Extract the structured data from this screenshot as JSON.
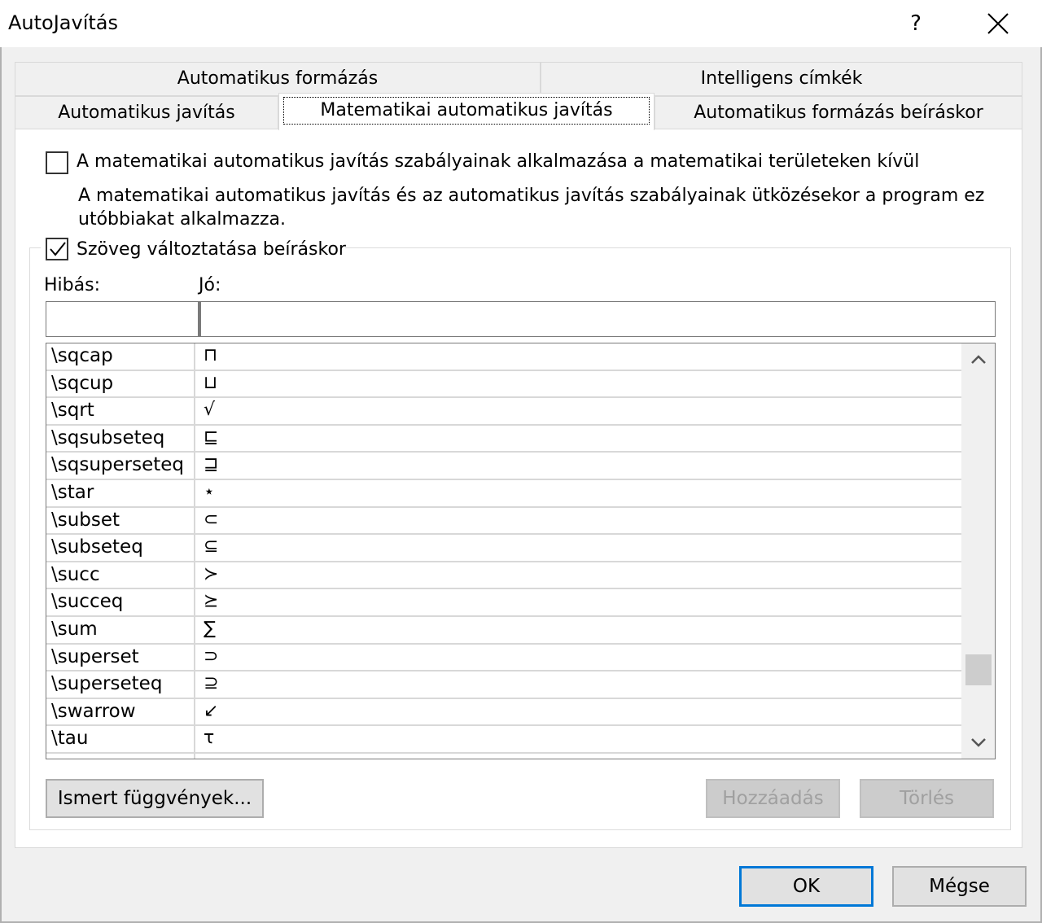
{
  "window": {
    "title": "AutoJavítás",
    "help_label": "?"
  },
  "tabs": {
    "row1": [
      "Automatikus formázás",
      "Intelligens címkék"
    ],
    "row2": [
      "Automatikus javítás",
      "Matematikai automatikus javítás",
      "Automatikus formázás beíráskor"
    ],
    "active": "Matematikai automatikus javítás"
  },
  "options": {
    "outside_math_label": "A matematikai automatikus javítás szabályainak alkalmazása a matematikai területeken kívül",
    "outside_math_checked": false,
    "conflict_note_line1": "A matematikai automatikus javítás és az automatikus javítás szabályainak ütközésekor a program ez",
    "conflict_note_line2": "utóbbiakat alkalmazza.",
    "replace_text_label": "Szöveg változtatása beíráskor",
    "replace_text_checked": true
  },
  "fields": {
    "wrong_label": "Hibás:",
    "right_label": "Jó:",
    "wrong_value": "",
    "right_value": ""
  },
  "list": {
    "rows": [
      {
        "bad": "\\sqcap",
        "good": "⊓"
      },
      {
        "bad": "\\sqcup",
        "good": "⊔"
      },
      {
        "bad": "\\sqrt",
        "good": "√"
      },
      {
        "bad": "\\sqsubseteq",
        "good": "⊑"
      },
      {
        "bad": "\\sqsuperseteq",
        "good": "⊒"
      },
      {
        "bad": "\\star",
        "good": "⋆"
      },
      {
        "bad": "\\subset",
        "good": "⊂"
      },
      {
        "bad": "\\subseteq",
        "good": "⊆"
      },
      {
        "bad": "\\succ",
        "good": "≻"
      },
      {
        "bad": "\\succeq",
        "good": "⪰"
      },
      {
        "bad": "\\sum",
        "good": "∑"
      },
      {
        "bad": "\\superset",
        "good": "⊃"
      },
      {
        "bad": "\\superseteq",
        "good": "⊇"
      },
      {
        "bad": "\\swarrow",
        "good": "↙"
      },
      {
        "bad": "\\tau",
        "good": "τ"
      }
    ],
    "scroll_position": 0.8
  },
  "buttons": {
    "known_functions": "Ismert függvények...",
    "add": "Hozzáadás",
    "delete": "Törlés",
    "ok": "OK",
    "cancel": "Mégse"
  },
  "colors": {
    "default_button_border": "#0078d7",
    "panel_background": "#ffffff",
    "frame_background": "#f0f0f0"
  }
}
